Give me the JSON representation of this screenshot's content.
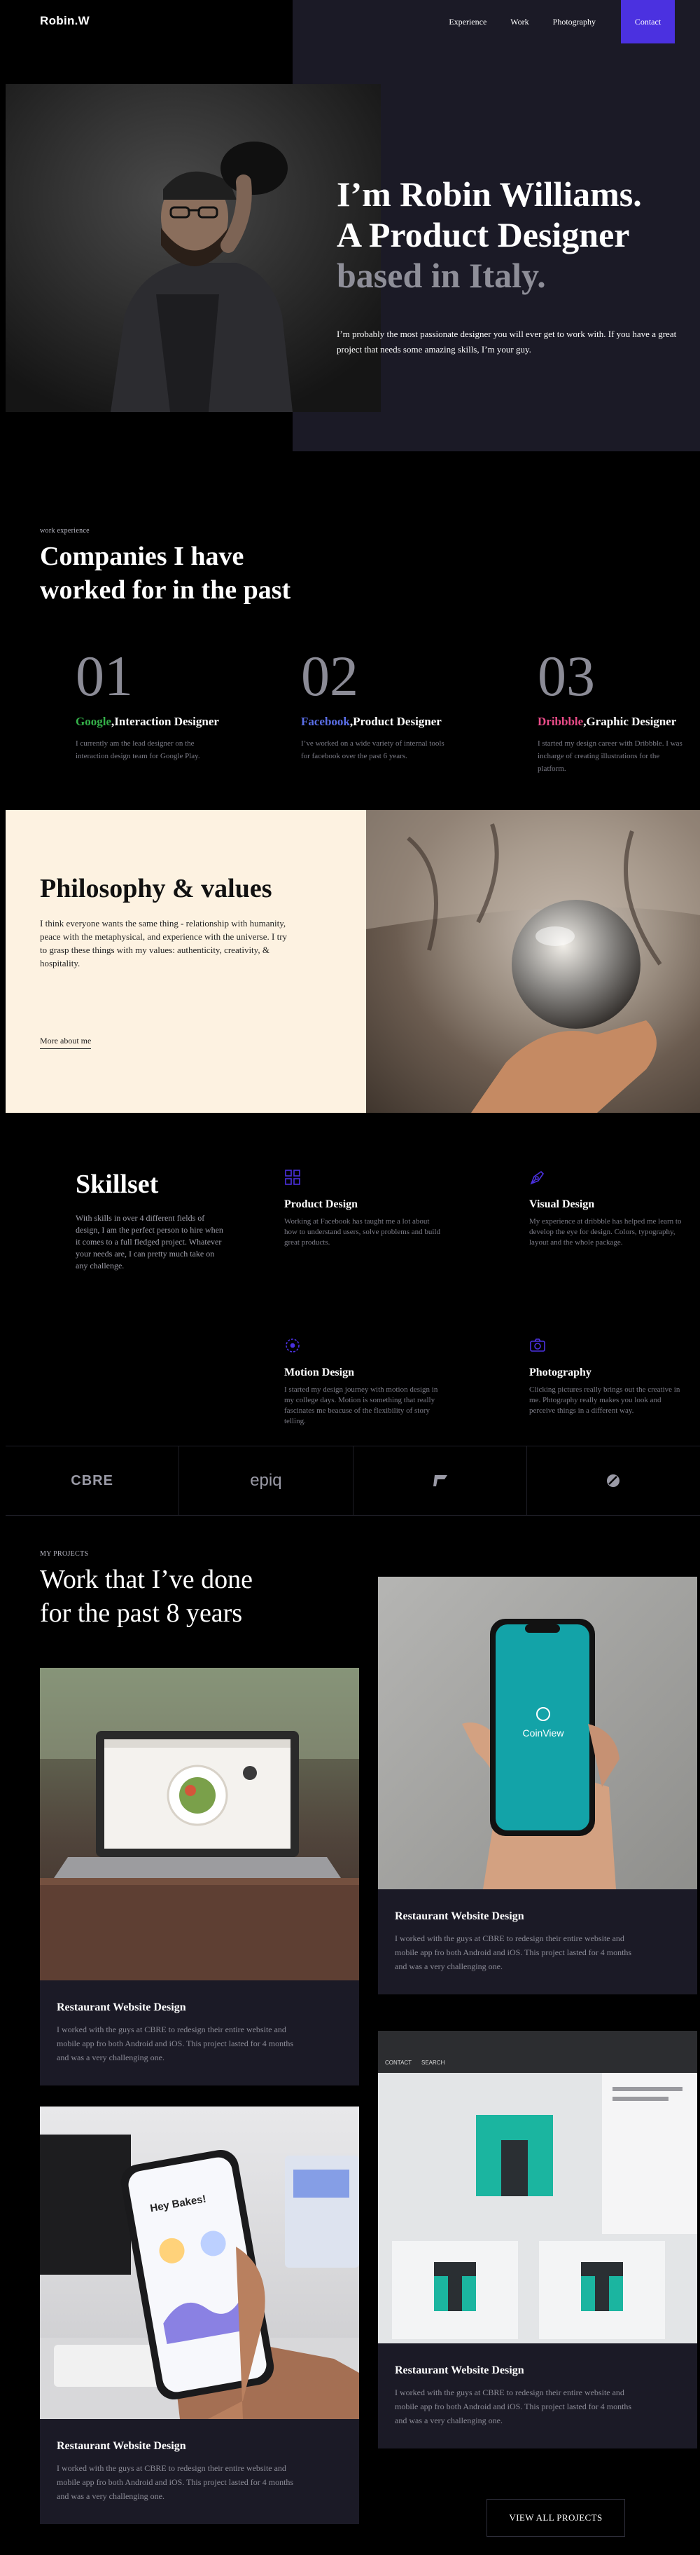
{
  "header": {
    "logo": "Robin.W",
    "nav": [
      "Experience",
      "Work",
      "Photography"
    ],
    "contact_label": "Contact"
  },
  "hero": {
    "line1": "I’m Robin Williams.",
    "line2": "A Product Designer",
    "line3": "based in Italy.",
    "subtitle": "I’m probably the most passionate designer you will ever get to work with. If you have a great project that needs some amazing skills, I’m your guy."
  },
  "experience": {
    "eyebrow": "work experience",
    "title_line1": "Companies I have",
    "title_line2": "worked for in the past",
    "items": [
      {
        "num": "01",
        "brand": "Google",
        "brand_color": "#35b24a",
        "role": ",Interaction Designer",
        "desc": "I currently am the lead designer on the interaction design team for Google Play."
      },
      {
        "num": "02",
        "brand": "Facebook",
        "brand_color": "#5b6fe8",
        "role": ",Product Designer",
        "desc": "I’ve worked on a wide variety of internal tools for facebook over the past 6 years."
      },
      {
        "num": "03",
        "brand": "Dribbble",
        "brand_color": "#ea4c89",
        "role": ",Graphic Designer",
        "desc": "I started my design career with Dribbble. I was incharge of creating illustrations for the platform."
      }
    ]
  },
  "philosophy": {
    "title": "Philosophy & values",
    "text": "I think everyone wants the same thing - relationship with humanity, peace with the metaphysical, and experience with the universe. I try to grasp these things with my values: authenticity, creativity, & hospitality.",
    "link": "More about me"
  },
  "skillset": {
    "title": "Skillset",
    "text": "With skills in over 4 different fields of design, I am the perfect person to hire when it comes to a full fledged project. Whatever your needs are, I can pretty much take on any challenge.",
    "accent": "#4b31e0",
    "items": [
      {
        "icon": "grid-icon",
        "title": "Product Design",
        "desc": "Working at Facebook has taught me a lot about how to understand users, solve problems and build great products."
      },
      {
        "icon": "pen-tool-icon",
        "title": "Visual Design",
        "desc": "My experience at dribbble has helped me learn to develop the eye for design. Colors, typography, layout and the whole package."
      },
      {
        "icon": "motion-circle-icon",
        "title": "Motion Design",
        "desc": "I started my design journey with motion design in my college days. Motion is something that really fascinates me beacuse of the flexibility of story telling."
      },
      {
        "icon": "camera-icon",
        "title": "Photography",
        "desc": "Clicking pictures really brings out the creative in me. Phtography really makes you look and perceive things in a different way."
      }
    ]
  },
  "logos": [
    "CBRE",
    "epiq",
    "flag-mark-logo",
    "leaf-mark-logo"
  ],
  "projects": {
    "eyebrow": "MY PROJECTS",
    "title_line1": "Work that I’ve done",
    "title_line2": "for the past 8 years",
    "cards": [
      {
        "title": "Restaurant Website Design",
        "desc": "I worked with the guys at CBRE to redesign their entire website and mobile app fro both Android and iOS. This project lasted for 4 months and was a very challenging one."
      },
      {
        "title": "Restaurant Website Design",
        "desc": "I worked with the guys at CBRE to redesign their entire website and mobile app fro both Android and iOS. This project lasted for 4 months and was a very challenging one."
      },
      {
        "title": "Restaurant Website Design",
        "desc": "I worked with the guys at CBRE to redesign their entire website and mobile app fro both Android and iOS. This project lasted for 4 months and was a very challenging one."
      },
      {
        "title": "Restaurant Website Design",
        "desc": "I worked with the guys at CBRE to redesign their entire website and mobile app fro both Android and iOS. This project lasted for 4 months and was a very challenging one."
      }
    ],
    "phone_app_name": "CoinView",
    "mock_nav": [
      "CONTACT",
      "SEARCH"
    ],
    "mock_greeting": "Hey Bakes!",
    "view_all": "VIEW ALL PROJECTS"
  }
}
